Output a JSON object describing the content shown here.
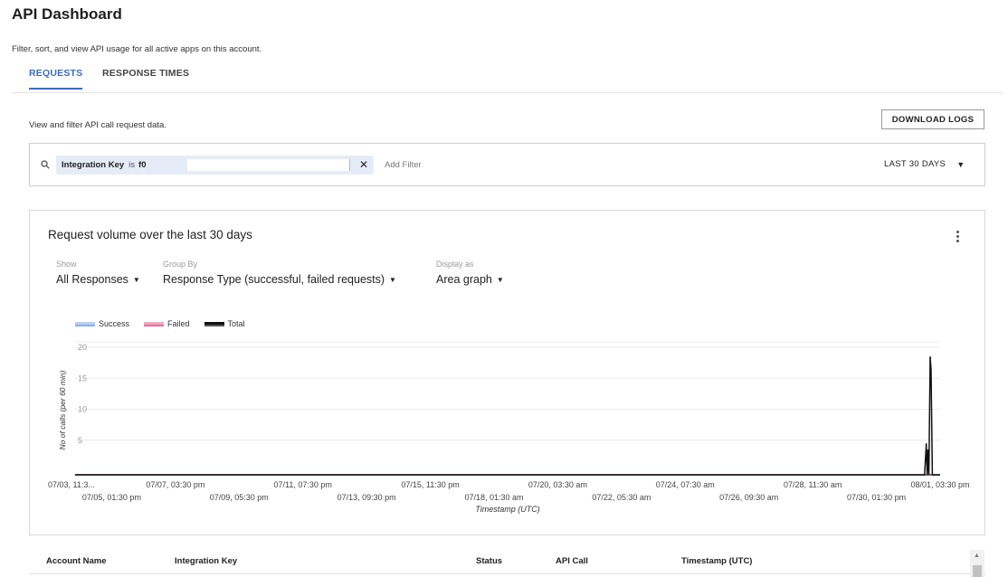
{
  "header": {
    "title": "API Dashboard",
    "description": "Filter, sort, and view API usage for all active apps on this account."
  },
  "tabs": [
    {
      "label": "REQUESTS",
      "active": true
    },
    {
      "label": "RESPONSE TIMES",
      "active": false
    }
  ],
  "requests": {
    "description": "View and filter API call request data.",
    "download_label": "DOWNLOAD LOGS"
  },
  "filter": {
    "chip": {
      "key": "Integration Key",
      "operator": "is",
      "value": "f0"
    },
    "add_placeholder": "Add Filter",
    "range_label": "LAST 30 DAYS"
  },
  "chart_card": {
    "title": "Request volume over the last 30 days",
    "controls": {
      "show": {
        "label": "Show",
        "value": "All Responses"
      },
      "group_by": {
        "label": "Group By",
        "value": "Response Type (successful, failed requests)"
      },
      "display_as": {
        "label": "Display as",
        "value": "Area graph"
      }
    }
  },
  "chart_data": {
    "type": "area",
    "ylabel": "No of calls (per 60 min)",
    "xlabel": "Timestamp (UTC)",
    "ylim": [
      0,
      20
    ],
    "yticks": [
      20,
      15,
      10,
      5
    ],
    "grid": true,
    "legend_position": "top-left",
    "legend": [
      {
        "name": "Success",
        "color": "#8fb2e8"
      },
      {
        "name": "Failed",
        "color": "#e8709a"
      },
      {
        "name": "Total",
        "color": "#111111"
      }
    ],
    "xticks_row1": [
      "07/03, 11:3...",
      "07/07, 03:30 pm",
      "07/11, 07:30 pm",
      "07/15, 11:30 pm",
      "07/20, 03:30 am",
      "07/24, 07:30 am",
      "07/28, 11:30 am",
      "08/01, 03:30 pm"
    ],
    "xticks_row2": [
      "07/05, 01:30 pm",
      "07/09, 05:30 pm",
      "07/13, 09:30 pm",
      "07/18, 01:30 am",
      "07/22, 05:30 am",
      "07/26, 09:30 am",
      "07/30, 01:30 pm"
    ],
    "total_series": [
      {
        "x": 0.0,
        "y": 0
      },
      {
        "x": 0.982,
        "y": 0
      },
      {
        "x": 0.984,
        "y": 5
      },
      {
        "x": 0.985,
        "y": 0
      },
      {
        "x": 0.986,
        "y": 4
      },
      {
        "x": 0.987,
        "y": 0
      },
      {
        "x": 0.9885,
        "y": 19
      },
      {
        "x": 0.9895,
        "y": 17
      },
      {
        "x": 0.991,
        "y": 0
      },
      {
        "x": 1.0,
        "y": 0
      }
    ]
  },
  "table": {
    "columns": [
      "Account Name",
      "Integration Key",
      "Status",
      "API Call",
      "Timestamp (UTC)"
    ]
  }
}
